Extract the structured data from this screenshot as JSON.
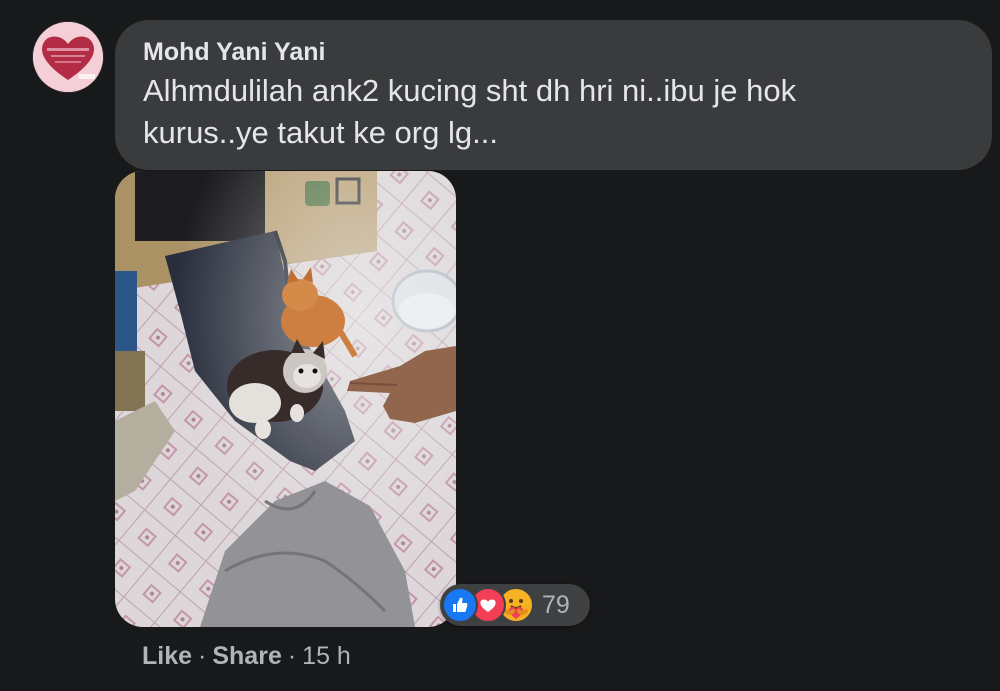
{
  "comment": {
    "author": "Mohd Yani Yani",
    "text": "Alhmdulilah ank2 kucing sht dh hri ni..ibu je hok kurus..ye takut ke org lg...",
    "reaction_icons": [
      "like-icon",
      "love-icon",
      "care-icon"
    ],
    "reaction_count": "79",
    "actions": {
      "like_label": "Like",
      "share_label": "Share",
      "separator": "·",
      "timestamp": "15 h"
    }
  },
  "colors": {
    "background": "#18191a",
    "bubble": "#3a3b3c",
    "primary_text": "#e4e6eb",
    "secondary_text": "#b0b3b8",
    "like_blue": "#1877f2",
    "love_red": "#f33e58",
    "care_yellow": "#f7b125"
  }
}
